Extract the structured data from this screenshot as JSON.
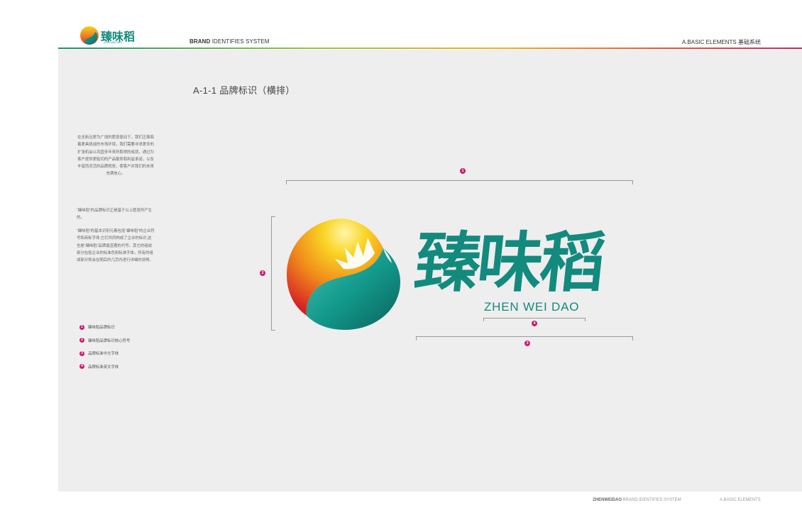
{
  "header": {
    "logo_text": "臻味稻",
    "logo_subtext": "ZHEN WEI DAO",
    "brand_bold": "BRAND",
    "brand_rest": " IDENTIFIES SYSTEM",
    "section_right": "A.BASIC ELEMENTS  基础系统"
  },
  "page": {
    "title": "A-1-1   品牌标识（横排）"
  },
  "side": {
    "para1": "在全新且更为广阔的愿景驱动下，我们正面临着更具挑战的市场环境，我们需要寻求更多的扩张机会以巩固多年来所取得的成就，通过为客户提供更贴切的产品服务和利益承诺，以及丰富而灵活的品牌视觉，使客户对我们的未来充满信心。",
    "para2": "“臻味稻”的品牌标识正是基于以上愿景所产生的。",
    "para3": "“臻味稻”的基本识别元素包括“臻味稻”的企业符号和商标字体,它们共同构成了企业的标识,这也是“臻味稻”品牌最显著的代号。其它的组成部分包括企业的标准色和标准字体。所有的组成部分将会在随后的几页内进行详细的说明。"
  },
  "legend": [
    {
      "num": "1",
      "label": "臻味稻品牌标识"
    },
    {
      "num": "2",
      "label": "臻味稻品牌标识核心符号"
    },
    {
      "num": "3",
      "label": "品牌标准中文字体"
    },
    {
      "num": "4",
      "label": "品牌标准英文字体"
    }
  ],
  "logo": {
    "chinese": "臻味稻",
    "latin": "ZHEN WEI DAO"
  },
  "markers": {
    "m1": "1",
    "m2": "2",
    "m3": "3",
    "m4": "4"
  },
  "footer": {
    "left_bold": "ZHENWEIDAO",
    "left_rest": " BRAND IDENTIFIES SYSTEM",
    "right": "A.BASIC ELEMENTS"
  },
  "colors": {
    "accent_magenta": "#cc1a72",
    "brand_teal": "#138a7e",
    "brand_orange": "#f29a1e",
    "brand_red": "#d7262b"
  }
}
